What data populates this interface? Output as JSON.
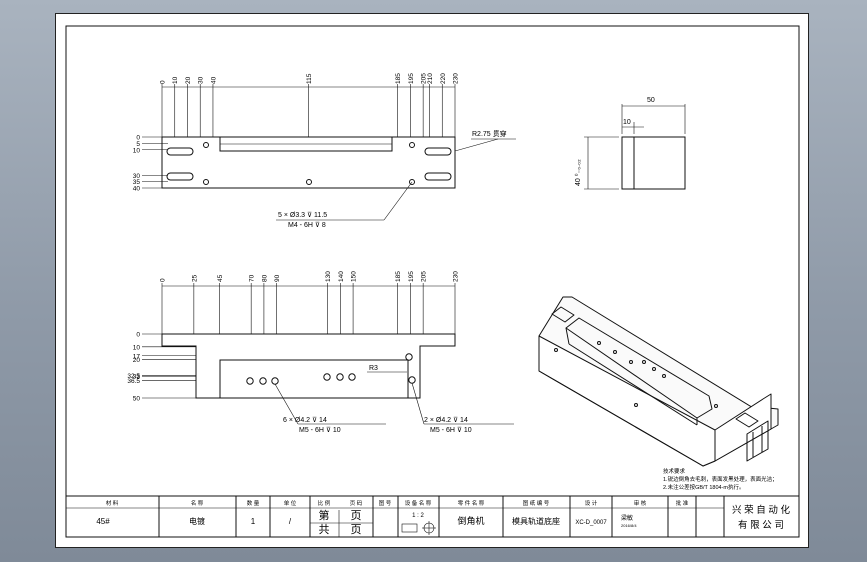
{
  "top_view": {
    "x_dims": [
      "0",
      "10",
      "20",
      "30",
      "40",
      "115",
      "185",
      "195",
      "205",
      "210",
      "220",
      "230"
    ],
    "y_dims": [
      "0",
      "5",
      "10",
      "30",
      "35",
      "40"
    ],
    "callout_slot": "R2.75 贯穿",
    "callout_holes": [
      "5 × Ø3.3 ⊽ 11.5",
      "M4 - 6H ⊽ 8"
    ]
  },
  "side_view": {
    "width_dim": "50",
    "small_dim": "10",
    "height_dim": "40 ⁰₋₀.₀₂"
  },
  "front_view": {
    "x_dims": [
      "0",
      "25",
      "45",
      "70",
      "80",
      "90",
      "130",
      "140",
      "150",
      "185",
      "195",
      "205",
      "230"
    ],
    "y_dims": [
      "0",
      "10",
      "17",
      "20",
      "32.5",
      "33",
      "36.5",
      "50"
    ],
    "radius": "R3",
    "callout_left": [
      "6 × Ø4.2 ⊽ 14",
      "M5 - 6H ⊽ 10"
    ],
    "callout_right": [
      "2 × Ø4.2 ⊽ 14",
      "M5 - 6H ⊽ 10"
    ]
  },
  "notes": {
    "title": "技术要求",
    "lines": [
      "1.锐边倒角去毛刺，表面发黑处理，表面光洁；",
      "2.未注公差按GB/T 1804-m执行。"
    ]
  },
  "title_block": {
    "headers": [
      "材 料",
      "名 称",
      "数 量",
      "单 位",
      "比 例",
      "页 码",
      "图 号",
      "设 备 名 称",
      "零 件 名 称",
      "图 纸 编 号",
      "设 计",
      "审 核",
      "批 准"
    ],
    "material": "45#",
    "name": "电镀",
    "quantity": "1",
    "unit": "/",
    "sheet_label_1": "第",
    "sheet_label_2": "页",
    "sheet_label_3": "共",
    "sheet_label_4": "页",
    "scale": "1 : 2",
    "equipment": "倒角机",
    "part_name": "模具轨道底座",
    "drawing_no": "XC-D_0007",
    "designer": "梁敏",
    "date": "2016/8/4",
    "company_1": "兴 荣 自 动 化",
    "company_2": "有 限 公 司"
  }
}
